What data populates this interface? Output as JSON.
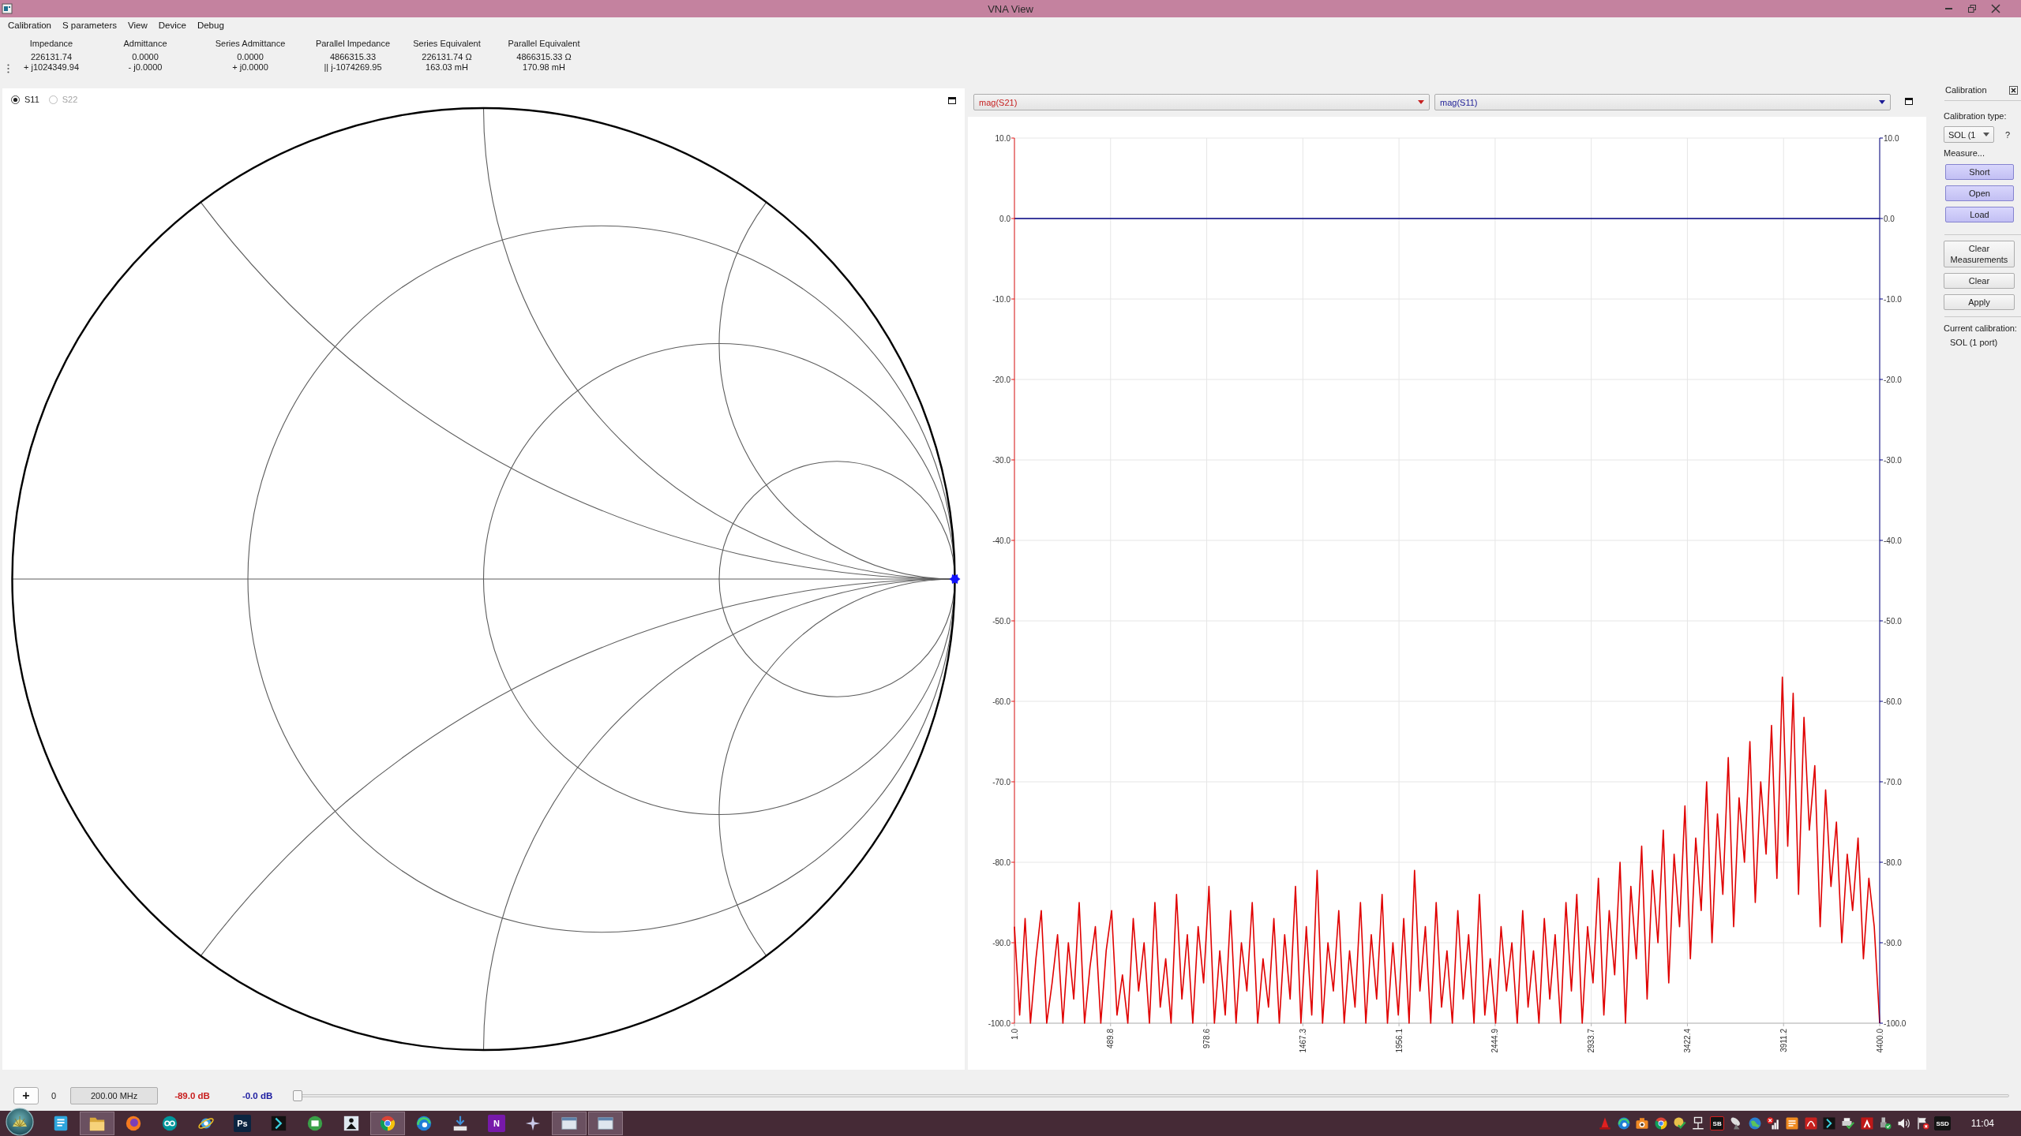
{
  "window": {
    "title": "VNA View"
  },
  "menu": [
    "Calibration",
    "S parameters",
    "View",
    "Device",
    "Debug"
  ],
  "readout": {
    "columns": [
      {
        "heading": "Impedance",
        "lines": [
          "226131.74",
          "+ j1024349.94"
        ]
      },
      {
        "heading": "Admittance",
        "lines": [
          "0.0000",
          "- j0.0000"
        ]
      },
      {
        "heading": "Series Admittance",
        "lines": [
          "0.0000",
          "+ j0.0000"
        ]
      },
      {
        "heading": "Parallel Impedance",
        "lines": [
          "4866315.33",
          "|| j-1074269.95"
        ]
      },
      {
        "heading": "Series Equivalent",
        "lines": [
          "226131.74 Ω",
          "163.03 mH"
        ]
      },
      {
        "heading": "Parallel Equivalent",
        "lines": [
          "4866315.33 Ω",
          "170.98 mH"
        ]
      }
    ]
  },
  "smith": {
    "radios": [
      {
        "label": "S11",
        "selected": true,
        "disabled": false
      },
      {
        "label": "S22",
        "selected": false,
        "disabled": true
      }
    ]
  },
  "graph": {
    "traces": [
      {
        "label": "mag(S21)",
        "color": "#c62020"
      },
      {
        "label": "mag(S11)",
        "color": "#1c1c96"
      }
    ],
    "chart_data": {
      "type": "line",
      "grid": true,
      "xlim": [
        1,
        4400
      ],
      "ylim": [
        -100,
        10
      ],
      "x": [
        1,
        27.5,
        55,
        82.5,
        110,
        137.5,
        165,
        192.5,
        220,
        247.5,
        275,
        302.5,
        330,
        357.5,
        385,
        412.5,
        440,
        467.5,
        495,
        522.5,
        550,
        577.5,
        605,
        632.5,
        660,
        687.5,
        715,
        742.5,
        770,
        797.5,
        825,
        852.5,
        880,
        907.5,
        935,
        962.5,
        990,
        1017.5,
        1045,
        1072.5,
        1100,
        1127.5,
        1155,
        1182.5,
        1210,
        1237.5,
        1265,
        1292.5,
        1320,
        1347.5,
        1375,
        1402.5,
        1430,
        1457.5,
        1485,
        1512.5,
        1540,
        1567.5,
        1595,
        1622.5,
        1650,
        1677.5,
        1705,
        1732.5,
        1760,
        1787.5,
        1815,
        1842.5,
        1870,
        1897.5,
        1925,
        1952.5,
        1980,
        2007.5,
        2035,
        2062.5,
        2090,
        2117.5,
        2145,
        2172.5,
        2200,
        2227.5,
        2255,
        2282.5,
        2310,
        2337.5,
        2365,
        2392.5,
        2420,
        2447.5,
        2475,
        2502.5,
        2530,
        2557.5,
        2585,
        2612.5,
        2640,
        2667.5,
        2695,
        2722.5,
        2750,
        2777.5,
        2805,
        2832.5,
        2860,
        2887.5,
        2915,
        2942.5,
        2970,
        2997.5,
        3025,
        3052.5,
        3080,
        3107.5,
        3135,
        3162.5,
        3190,
        3217.5,
        3245,
        3272.5,
        3300,
        3327.5,
        3355,
        3382.5,
        3410,
        3437.5,
        3465,
        3492.5,
        3520,
        3547.5,
        3575,
        3602.5,
        3630,
        3657.5,
        3685,
        3712.5,
        3740,
        3767.5,
        3795,
        3822.5,
        3850,
        3877.5,
        3905,
        3932.5,
        3960,
        3987.5,
        4015,
        4042.5,
        4070,
        4097.5,
        4125,
        4152.5,
        4180,
        4207.5,
        4235,
        4262.5,
        4290,
        4317.5,
        4345,
        4372.5,
        4400
      ],
      "xticks": [
        {
          "value": 1,
          "label": "1.0"
        },
        {
          "value": 489.8,
          "label": "489.8"
        },
        {
          "value": 978.6,
          "label": "978.6"
        },
        {
          "value": 1467.3,
          "label": "1467.3"
        },
        {
          "value": 1956.1,
          "label": "1956.1"
        },
        {
          "value": 2444.9,
          "label": "2444.9"
        },
        {
          "value": 2933.7,
          "label": "2933.7"
        },
        {
          "value": 3422.4,
          "label": "3422.4"
        },
        {
          "value": 3911.2,
          "label": "3911.2"
        },
        {
          "value": 4400,
          "label": "4400.0"
        }
      ],
      "yticks": [
        {
          "value": -100,
          "label": "-100.0"
        },
        {
          "value": -90,
          "label": "-90.0"
        },
        {
          "value": -80,
          "label": "-80.0"
        },
        {
          "value": -70,
          "label": "-70.0"
        },
        {
          "value": -60,
          "label": "-60.0"
        },
        {
          "value": -50,
          "label": "-50.0"
        },
        {
          "value": -40,
          "label": "-40.0"
        },
        {
          "value": -30,
          "label": "-30.0"
        },
        {
          "value": -20,
          "label": "-20.0"
        },
        {
          "value": -10,
          "label": "-10.0"
        },
        {
          "value": 0,
          "label": "0.0"
        },
        {
          "value": 10,
          "label": "10.0"
        }
      ],
      "series": [
        {
          "color": "#e00000",
          "values": [
            -88,
            -99,
            -87,
            -100,
            -92,
            -86,
            -100,
            -95,
            -89,
            -100,
            -90,
            -97,
            -85,
            -100,
            -93,
            -88,
            -100,
            -91,
            -86,
            -99,
            -94,
            -100,
            -87,
            -96,
            -90,
            -100,
            -85,
            -98,
            -92,
            -100,
            -84,
            -97,
            -89,
            -100,
            -88,
            -95,
            -83,
            -100,
            -91,
            -99,
            -86,
            -100,
            -90,
            -96,
            -85,
            -100,
            -92,
            -98,
            -87,
            -100,
            -89,
            -97,
            -83,
            -100,
            -88,
            -99,
            -81,
            -100,
            -90,
            -96,
            -86,
            -100,
            -91,
            -98,
            -85,
            -100,
            -89,
            -97,
            -84,
            -100,
            -90,
            -99,
            -87,
            -100,
            -81,
            -96,
            -88,
            -100,
            -85,
            -98,
            -91,
            -100,
            -86,
            -97,
            -89,
            -100,
            -84,
            -99,
            -92,
            -100,
            -88,
            -96,
            -90,
            -100,
            -86,
            -98,
            -91,
            -100,
            -87,
            -97,
            -89,
            -100,
            -85,
            -96,
            -84,
            -100,
            -88,
            -95,
            -82,
            -99,
            -86,
            -94,
            -80,
            -100,
            -83,
            -92,
            -78,
            -97,
            -81,
            -90,
            -76,
            -95,
            -79,
            -88,
            -73,
            -92,
            -77,
            -86,
            -70,
            -90,
            -74,
            -84,
            -67,
            -88,
            -72,
            -80,
            -65,
            -85,
            -70,
            -79,
            -63,
            -82,
            -57,
            -78,
            -59,
            -84,
            -62,
            -76,
            -68,
            -88,
            -71,
            -83,
            -75,
            -90,
            -79,
            -86,
            -77,
            -92,
            -82,
            -88,
            -100
          ]
        },
        {
          "color": "#000080",
          "values": [
            0,
            0,
            0,
            0,
            0,
            0,
            0,
            0,
            0,
            0,
            0,
            0,
            0,
            0,
            0,
            0,
            0,
            0,
            0,
            0,
            0,
            0,
            0,
            0,
            0,
            0,
            0,
            0,
            0,
            0,
            0,
            0,
            0,
            0,
            0,
            0,
            0,
            0,
            0,
            0,
            0,
            0,
            0,
            0,
            0,
            0,
            0,
            0,
            0,
            0,
            0,
            0,
            0,
            0,
            0,
            0,
            0,
            0,
            0,
            0,
            0,
            0,
            0,
            0,
            0,
            0,
            0,
            0,
            0,
            0,
            0,
            0,
            0,
            0,
            0,
            0,
            0,
            0,
            0,
            0,
            0,
            0,
            0,
            0,
            0,
            0,
            0,
            0,
            0,
            0,
            0,
            0,
            0,
            0,
            0,
            0,
            0,
            0,
            0,
            0,
            0,
            0,
            0,
            0,
            0,
            0,
            0,
            0,
            0,
            0,
            0,
            0,
            0,
            0,
            0,
            0,
            0,
            0,
            0,
            0,
            0,
            0,
            0,
            0,
            0,
            0,
            0,
            0,
            0,
            0,
            0,
            0,
            0,
            0,
            0,
            0,
            0,
            0,
            0,
            0,
            0,
            0,
            0,
            0,
            0,
            0,
            0,
            0,
            0,
            0,
            0,
            0,
            0,
            0,
            0,
            0,
            0,
            0,
            0,
            0,
            0
          ]
        }
      ]
    }
  },
  "calibration": {
    "title": "Calibration",
    "type_label": "Calibration type:",
    "type_value": "SOL (1",
    "help": "?",
    "measure_label": "Measure...",
    "measure_buttons": [
      "Short",
      "Open",
      "Load"
    ],
    "action_buttons": [
      "Clear Measurements",
      "Clear",
      "Apply"
    ],
    "current_label": "Current calibration:",
    "current_value": "SOL (1 port)"
  },
  "bottom_bar": {
    "add_button": "+",
    "marker_index": "0",
    "frequency": "200.00 MHz",
    "readings": [
      {
        "text": "-89.0 dB",
        "color": "#c81e1e"
      },
      {
        "text": "-0.0 dB",
        "color": "#1c1ca0"
      }
    ],
    "slider": {
      "level": 0
    }
  },
  "taskbar": {
    "apps": [
      {
        "kind": "document",
        "active": false
      },
      {
        "kind": "folder",
        "active": true
      },
      {
        "kind": "orb",
        "active": false
      },
      {
        "kind": "infinity",
        "active": false
      },
      {
        "kind": "orbit",
        "active": false
      },
      {
        "kind": "tile",
        "label": "Ps",
        "color": "#0b2440",
        "active": false
      },
      {
        "kind": "chevron",
        "active": false
      },
      {
        "kind": "disc",
        "active": false
      },
      {
        "kind": "reader",
        "active": false
      },
      {
        "kind": "wheel",
        "active": true
      },
      {
        "kind": "swirl",
        "active": false
      },
      {
        "kind": "download",
        "active": false
      },
      {
        "kind": "tile",
        "label": "N",
        "color": "#7719aa",
        "active": false
      },
      {
        "kind": "sparkle",
        "active": false
      },
      {
        "kind": "window",
        "active": true
      },
      {
        "kind": "window",
        "active": true
      }
    ],
    "tray": [
      {
        "kind": "cone"
      },
      {
        "kind": "swirl"
      },
      {
        "kind": "camera"
      },
      {
        "kind": "wheel"
      },
      {
        "kind": "check-disc"
      },
      {
        "kind": "network"
      },
      {
        "kind": "outlined-tile",
        "label": "SB"
      },
      {
        "kind": "dish"
      },
      {
        "kind": "globe"
      },
      {
        "kind": "signal-x"
      },
      {
        "kind": "doc"
      },
      {
        "kind": "curl"
      },
      {
        "kind": "chevron"
      },
      {
        "kind": "printer-check"
      },
      {
        "kind": "triangle"
      },
      {
        "kind": "usb-check"
      },
      {
        "kind": "speaker"
      },
      {
        "kind": "flag-x"
      },
      {
        "kind": "tile",
        "label": "SSD"
      }
    ],
    "clock": "11:04"
  }
}
